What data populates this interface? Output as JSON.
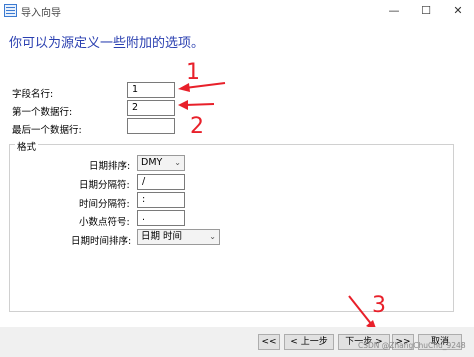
{
  "window": {
    "title": "导入向导",
    "minimize": "—",
    "maximize": "☐",
    "close": "✕"
  },
  "heading": "你可以为源定义一些附加的选项。",
  "fields": {
    "field_name_row": {
      "label": "字段名行:",
      "value": "1"
    },
    "first_data_row": {
      "label": "第一个数据行:",
      "value": "2"
    },
    "last_data_row": {
      "label": "最后一个数据行:",
      "value": ""
    }
  },
  "format": {
    "legend": "格式",
    "date_order": {
      "label": "日期排序:",
      "value": "DMY"
    },
    "date_separator": {
      "label": "日期分隔符:",
      "value": "/"
    },
    "time_separator": {
      "label": "时间分隔符:",
      "value": ":"
    },
    "decimal_symbol": {
      "label": "小数点符号:",
      "value": "."
    },
    "datetime_order": {
      "label": "日期时间排序:",
      "value": "日期 时间"
    }
  },
  "buttons": {
    "first": "<<",
    "prev": "< 上一步",
    "next": "下一步 >",
    "last": ">>",
    "cancel": "取消"
  },
  "annotations": {
    "one": "1",
    "two": "2",
    "three": "3"
  },
  "watermark": "CSDN @ZhangChuChu_9248",
  "colors": {
    "heading": "#2a3fb0",
    "annotation": "#e8202a"
  }
}
